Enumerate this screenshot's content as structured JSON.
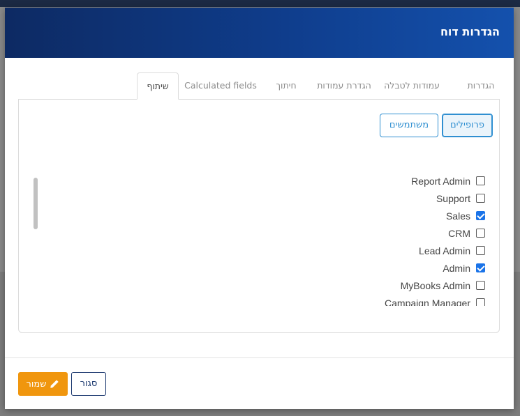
{
  "modal": {
    "title": "הגדרות דוח"
  },
  "tabs": [
    {
      "label": "הגדרות",
      "active": false
    },
    {
      "label": "עמודות לטבלה",
      "active": false
    },
    {
      "label": "הגדרת עמודות",
      "active": false
    },
    {
      "label": "חיתוך",
      "active": false
    },
    {
      "label": "Calculated fields",
      "active": false
    },
    {
      "label": "שיתוף",
      "active": true
    }
  ],
  "share": {
    "profiles_button": "פרופילים",
    "users_button": "משתמשים",
    "profiles": [
      {
        "label": "Report Admin",
        "checked": false
      },
      {
        "label": "Support",
        "checked": false
      },
      {
        "label": "Sales",
        "checked": true
      },
      {
        "label": "CRM",
        "checked": false
      },
      {
        "label": "Lead Admin",
        "checked": false
      },
      {
        "label": "Admin",
        "checked": true
      },
      {
        "label": "MyBooks Admin",
        "checked": false
      },
      {
        "label": "Campaign Manager",
        "checked": false
      }
    ]
  },
  "footer": {
    "save_label": "שמור",
    "close_label": "סגור"
  },
  "colors": {
    "header": "#0f3d8c",
    "accent_blue": "#2f8fd1",
    "save_orange": "#f0960e",
    "checkbox_checked": "#1a73e8"
  },
  "icons": {
    "save": "pencil-icon"
  }
}
